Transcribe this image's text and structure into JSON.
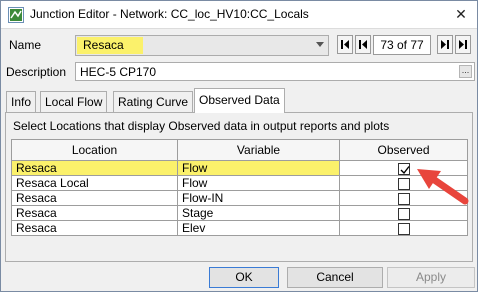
{
  "window": {
    "title": "Junction Editor - Network: CC_loc_HV10:CC_Locals",
    "close_glyph": "✕"
  },
  "name_field": {
    "label": "Name",
    "value": "Resaca"
  },
  "navigator": {
    "counter": "73 of 77"
  },
  "description": {
    "label": "Description",
    "value": "HEC-5 CP170",
    "ellipsis": "..."
  },
  "tabs": [
    {
      "label": "Info"
    },
    {
      "label": "Local Flow"
    },
    {
      "label": "Rating Curve"
    },
    {
      "label": "Observed Data"
    }
  ],
  "active_tab": "Observed Data",
  "panel": {
    "instructions": "Select Locations that display Observed data in output reports and plots"
  },
  "table": {
    "headers": [
      "Location",
      "Variable",
      "Observed"
    ],
    "rows": [
      {
        "location": "Resaca",
        "variable": "Flow",
        "observed": true
      },
      {
        "location": "Resaca Local",
        "variable": "Flow",
        "observed": false
      },
      {
        "location": "Resaca",
        "variable": "Flow-IN",
        "observed": false
      },
      {
        "location": "Resaca",
        "variable": "Stage",
        "observed": false
      },
      {
        "location": "Resaca",
        "variable": "Elev",
        "observed": false
      }
    ]
  },
  "buttons": {
    "ok": "OK",
    "cancel": "Cancel",
    "apply": "Apply"
  },
  "colors": {
    "highlight": "#fbf16b",
    "annotation_arrow": "#e8453c"
  }
}
